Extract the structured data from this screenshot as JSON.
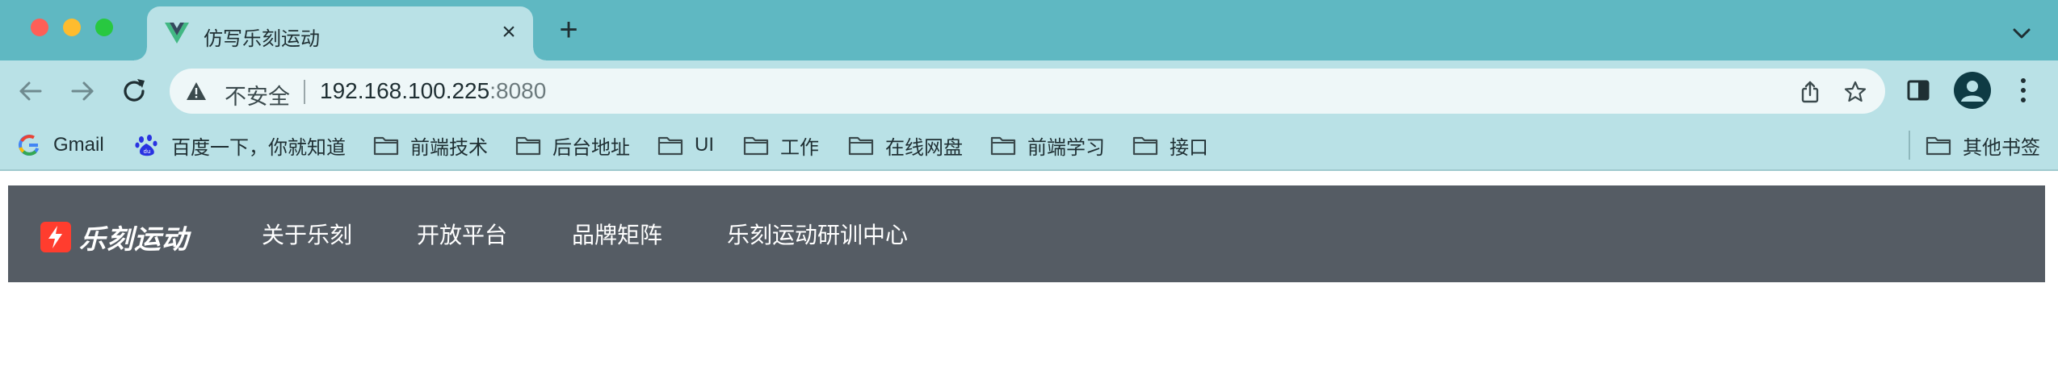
{
  "window": {
    "tab": {
      "title": "仿写乐刻运动",
      "favicon": "vue-logo-icon"
    },
    "new_tab_symbol": "+",
    "close_symbol": "×"
  },
  "toolbar": {
    "security_label": "不安全",
    "url_host": "192.168.100.225",
    "url_port": ":8080"
  },
  "bookmarks": {
    "items": [
      {
        "label": "Gmail",
        "icon": "google-icon"
      },
      {
        "label": "百度一下，你就知道",
        "icon": "baidu-icon"
      },
      {
        "label": "前端技术",
        "icon": "folder-icon"
      },
      {
        "label": "后台地址",
        "icon": "folder-icon"
      },
      {
        "label": "UI",
        "icon": "folder-icon"
      },
      {
        "label": "工作",
        "icon": "folder-icon"
      },
      {
        "label": "在线网盘",
        "icon": "folder-icon"
      },
      {
        "label": "前端学习",
        "icon": "folder-icon"
      },
      {
        "label": "接口",
        "icon": "folder-icon"
      }
    ],
    "other": {
      "label": "其他书签",
      "icon": "folder-icon"
    }
  },
  "page": {
    "logo_text": "乐刻运动",
    "nav": [
      {
        "label": "关于乐刻"
      },
      {
        "label": "开放平台"
      },
      {
        "label": "品牌矩阵"
      },
      {
        "label": "乐刻运动研训中心"
      }
    ]
  },
  "colors": {
    "tabstrip": "#5fb8c2",
    "toolbar": "#b9e1e6",
    "site_nav": "#555c64",
    "logo_accent": "#ff3d2e"
  }
}
